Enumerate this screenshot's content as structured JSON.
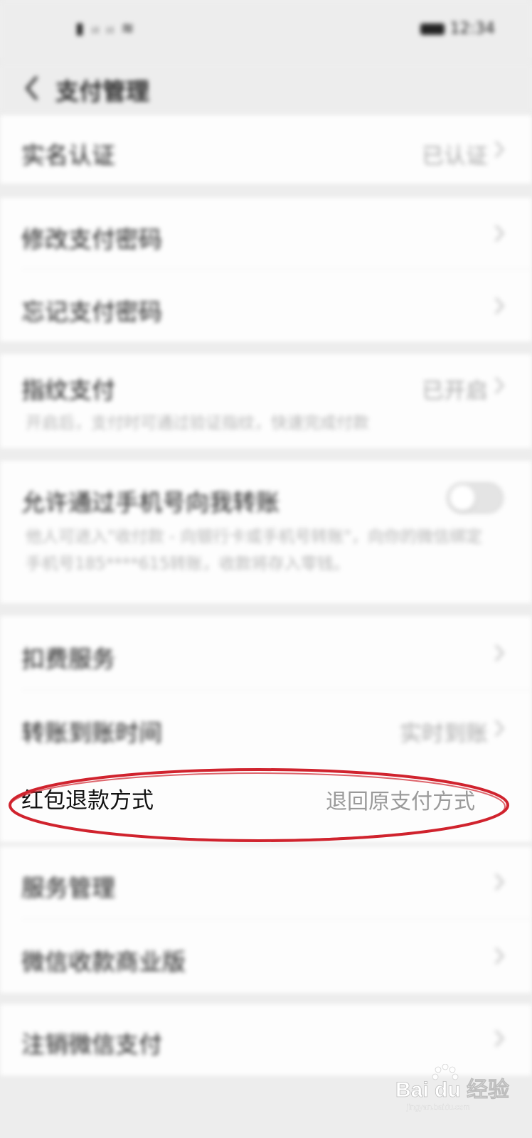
{
  "status_bar": {
    "left": "▮ ᵢₗ ᵢₗ ≋",
    "right": "12:34"
  },
  "nav": {
    "title": "支付管理"
  },
  "rows": {
    "real_name": {
      "label": "实名认证",
      "value": "已认证"
    },
    "modify_password": {
      "label": "修改支付密码"
    },
    "forgot_password": {
      "label": "忘记支付密码"
    },
    "fingerprint": {
      "label": "指纹支付",
      "value": "已开启",
      "desc": "开启后，支付时可通过验证指纹，快速完成付款"
    },
    "phone_transfer": {
      "label": "允许通过手机号向我转账",
      "desc": "他人可进入\"收付款 - 向银行卡或手机号转账\"，向你的微信绑定手机号185****615转账，收款将存入零钱。",
      "enabled": false
    },
    "deduction_service": {
      "label": "扣费服务"
    },
    "transfer_arrival": {
      "label": "转账到账时间",
      "value": "实时到账"
    },
    "refund_method": {
      "label": "红包退款方式",
      "value": "退回原支付方式"
    },
    "service_management": {
      "label": "服务管理"
    },
    "merchant_assistant": {
      "label": "微信收款商业版"
    },
    "cancel_wechat_pay": {
      "label": "注销微信支付"
    }
  },
  "annotation": {
    "color": "#d0232e"
  },
  "watermark": {
    "brand": "Bai du 经验",
    "url": "jingyan.baidu.com"
  }
}
